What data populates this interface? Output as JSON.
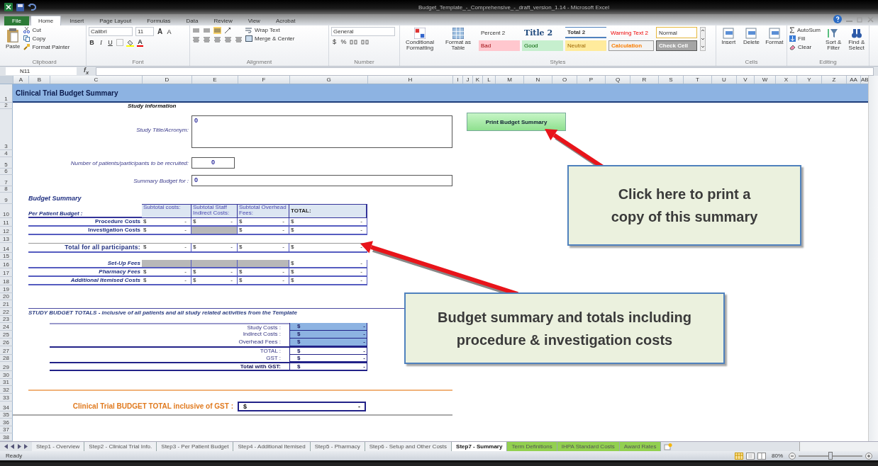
{
  "window": {
    "title": "Budget_Template_-_Comprehensive_-_draft_version_1.14 - Microsoft Excel"
  },
  "ribbon_tabs": [
    {
      "label": "File",
      "selected": false,
      "kind": "file"
    },
    {
      "label": "Home",
      "selected": true,
      "kind": "tab"
    },
    {
      "label": "Insert",
      "selected": false,
      "kind": "tab"
    },
    {
      "label": "Page Layout",
      "selected": false,
      "kind": "tab"
    },
    {
      "label": "Formulas",
      "selected": false,
      "kind": "tab"
    },
    {
      "label": "Data",
      "selected": false,
      "kind": "tab"
    },
    {
      "label": "Review",
      "selected": false,
      "kind": "tab"
    },
    {
      "label": "View",
      "selected": false,
      "kind": "tab"
    },
    {
      "label": "Acrobat",
      "selected": false,
      "kind": "tab"
    }
  ],
  "ribbon": {
    "clipboard": {
      "paste": "Paste",
      "cut": "Cut",
      "copy": "Copy",
      "format_painter": "Format Painter",
      "label": "Clipboard"
    },
    "font": {
      "family": "Calibri",
      "size": "11",
      "grow": "A",
      "shrink": "A",
      "bold": "B",
      "italic": "I",
      "underline": "U",
      "font_color": "A",
      "label": "Font"
    },
    "alignment": {
      "wrap": "Wrap Text",
      "merge": "Merge & Center",
      "label": "Alignment"
    },
    "number": {
      "format": "General",
      "currency": "$",
      "percent": "%",
      "label": "Number"
    },
    "styles": {
      "conditional": "Conditional Formatting",
      "table": "Format as Table",
      "label": "Styles",
      "cells": [
        {
          "label": "Percent 2",
          "kind": "plain"
        },
        {
          "label": "Title 2",
          "kind": "title"
        },
        {
          "label": "Total 2",
          "kind": "total"
        },
        {
          "label": "Warning Text 2",
          "kind": "warning"
        },
        {
          "label": "Normal",
          "kind": "normal"
        },
        {
          "label": "Bad",
          "kind": "bad"
        },
        {
          "label": "Good",
          "kind": "good"
        },
        {
          "label": "Neutral",
          "kind": "neutral"
        },
        {
          "label": "Calculation",
          "kind": "calculation"
        },
        {
          "label": "Check Cell",
          "kind": "check"
        }
      ]
    },
    "cells": {
      "buttons": [
        "Insert",
        "Delete",
        "Format"
      ],
      "label": "Cells"
    },
    "editing": {
      "autosum": "AutoSum",
      "fill": "Fill",
      "clear": "Clear",
      "sort": "Sort & Filter",
      "find": "Find & Select",
      "label": "Editing"
    }
  },
  "formula_bar": {
    "name_box": "N11",
    "fx": "f$_{x}$"
  },
  "sheet": {
    "columns": [
      "A",
      "B",
      "C",
      "D",
      "E",
      "F",
      "G",
      "H",
      "I",
      "J",
      "K",
      "L",
      "M",
      "N",
      "O",
      "P",
      "Q",
      "R",
      "S",
      "T",
      "U",
      "V",
      "W",
      "X",
      "Y",
      "Z",
      "AA",
      "AB"
    ],
    "rows": [
      "1",
      "2",
      "3",
      "4",
      "5",
      "6",
      "7",
      "8",
      "9",
      "10",
      "11",
      "12",
      "13",
      "14",
      "15",
      "16",
      "17",
      "18",
      "19",
      "20",
      "21",
      "22",
      "23",
      "24",
      "25",
      "26",
      "27",
      "28",
      "29",
      "30",
      "31",
      "32",
      "33",
      "34",
      "35",
      "36",
      "37",
      "38"
    ],
    "title": "Clinical Trial Budget Summary",
    "study_info": {
      "heading": "Study information",
      "title_label": "Study Title/Acronym:",
      "title_value": "0",
      "participants_label": "Number of patients/participants to be recruited:",
      "participants_value": "0",
      "budget_for_label": "Summary Budget for :",
      "budget_for_value": "0"
    },
    "print_button": "Print Budget Summary",
    "budget_summary": {
      "heading": "Budget Summary",
      "per_patient": "Per Patient Budget :",
      "columns": [
        "Subtotal costs:",
        "Subtotal Staff Indirect Costs:",
        "Subtotal Overhead Fees:",
        "TOTAL:"
      ],
      "rows": [
        {
          "label": "Procedure Costs",
          "kind": "item",
          "cells": [
            {
              "kind": "value",
              "currency": "$",
              "amount": "-"
            },
            {
              "kind": "value",
              "currency": "$",
              "amount": "-"
            },
            {
              "kind": "value",
              "currency": "$",
              "amount": "-"
            },
            {
              "kind": "value",
              "currency": "$",
              "amount": "-"
            }
          ]
        },
        {
          "label": "Investigation Costs",
          "kind": "item",
          "cells": [
            {
              "kind": "value",
              "currency": "$",
              "amount": "-"
            },
            {
              "kind": "shaded"
            },
            {
              "kind": "value",
              "currency": "$",
              "amount": "-"
            },
            {
              "kind": "value",
              "currency": "$",
              "amount": "-"
            }
          ]
        },
        {
          "label": "Total for all  participants:",
          "kind": "total",
          "cells": [
            {
              "kind": "value",
              "currency": "$",
              "amount": "-"
            },
            {
              "kind": "value",
              "currency": "$",
              "amount": "-"
            },
            {
              "kind": "value",
              "currency": "$",
              "amount": "-"
            },
            {
              "kind": "value",
              "currency": "$",
              "amount": "-"
            }
          ]
        },
        {
          "label": "Set-Up Fees",
          "kind": "fee",
          "cells": [
            {
              "kind": "shaded"
            },
            {
              "kind": "shaded"
            },
            {
              "kind": "shaded"
            },
            {
              "kind": "value",
              "currency": "$",
              "amount": "-"
            }
          ]
        },
        {
          "label": "Pharmacy Fees",
          "kind": "fee",
          "cells": [
            {
              "kind": "value",
              "currency": "$",
              "amount": "-"
            },
            {
              "kind": "value",
              "currency": "$",
              "amount": "-"
            },
            {
              "kind": "value",
              "currency": "$",
              "amount": "-"
            },
            {
              "kind": "value",
              "currency": "$",
              "amount": "-"
            }
          ]
        },
        {
          "label": "Additional Itemised Costs",
          "kind": "fee",
          "cells": [
            {
              "kind": "value",
              "currency": "$",
              "amount": "-"
            },
            {
              "kind": "value",
              "currency": "$",
              "amount": "-"
            },
            {
              "kind": "value",
              "currency": "$",
              "amount": "-"
            },
            {
              "kind": "value",
              "currency": "$",
              "amount": "-"
            }
          ]
        }
      ]
    },
    "totals": {
      "heading": "STUDY BUDGET TOTALS - inclusive of all patients and all study related activities from the Template",
      "rows": [
        {
          "label": "Study Costs :",
          "currency": "$",
          "amount": "-",
          "highlighted": true,
          "emphasis": false
        },
        {
          "label": "Indirect Costs :",
          "currency": "$",
          "amount": "-",
          "highlighted": true,
          "emphasis": false
        },
        {
          "label": "Overhead Fees :",
          "currency": "$",
          "amount": "-",
          "highlighted": true,
          "emphasis": false
        },
        {
          "label": "TOTAL :",
          "currency": "$",
          "amount": "-",
          "highlighted": false,
          "emphasis": false
        },
        {
          "label": "GST :",
          "currency": "$",
          "amount": "-",
          "highlighted": false,
          "emphasis": false
        },
        {
          "label": "Total with GST:",
          "currency": "$",
          "amount": "-",
          "highlighted": false,
          "emphasis": true
        }
      ]
    },
    "grand_total": {
      "label": "Clinical Trial BUDGET TOTAL inclusive of GST :",
      "currency": "$",
      "amount": "-"
    }
  },
  "callouts": [
    {
      "text": "Click here to print a copy of this summary"
    },
    {
      "text": "Budget summary and totals including procedure & investigation costs"
    }
  ],
  "sheet_tabs": [
    {
      "label": "Step1 - Overview",
      "selected": false
    },
    {
      "label": "Step2 - Clinical Trial Info.",
      "selected": false
    },
    {
      "label": "Step3 - Per Patient Budget",
      "selected": false
    },
    {
      "label": "Step4 - Additional Itemised",
      "selected": false
    },
    {
      "label": "Step5 - Pharmacy",
      "selected": false
    },
    {
      "label": "Step6 - Setup and Other Costs",
      "selected": false
    },
    {
      "label": "Step7 - Summary",
      "selected": true
    },
    {
      "label": "Term Definitions",
      "selected": false,
      "color": "#92d050"
    },
    {
      "label": "IHPA Standard Costs",
      "selected": false,
      "color": "#92d050"
    },
    {
      "label": "Award Rates",
      "selected": false,
      "color": "#92d050"
    }
  ],
  "status_bar": {
    "text": "Ready",
    "zoom": "80%",
    "zoom_slider": {
      "level": 0.5
    }
  }
}
